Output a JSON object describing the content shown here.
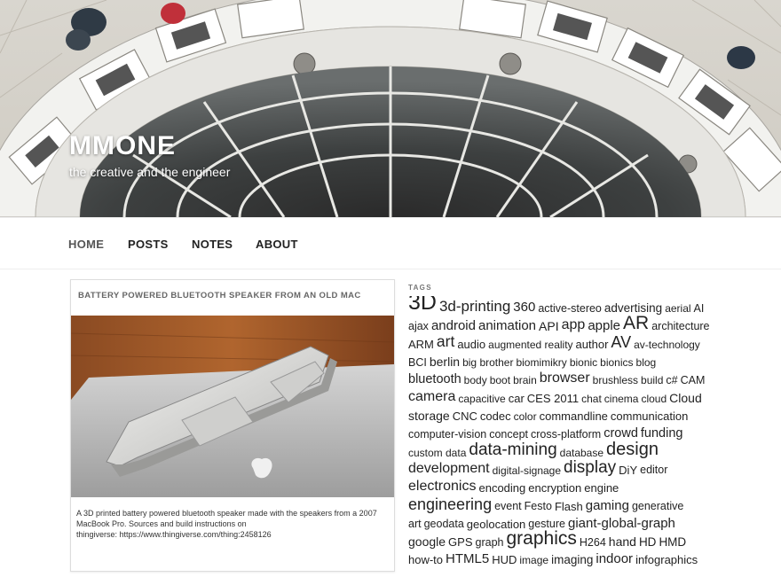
{
  "site": {
    "title": "MMONE",
    "tagline": "the creative and the engineer"
  },
  "nav": {
    "items": [
      {
        "label": "HOME",
        "name": "nav-item-home"
      },
      {
        "label": "POSTS",
        "name": "nav-item-posts"
      },
      {
        "label": "NOTES",
        "name": "nav-item-notes"
      },
      {
        "label": "ABOUT",
        "name": "nav-item-about"
      }
    ]
  },
  "post": {
    "title": "BATTERY POWERED BLUETOOTH SPEAKER FROM AN OLD MAC",
    "caption_line1": "A 3D printed battery powered bluetooth speaker made with the speakers from a 2007",
    "caption_line2": "MacBook Pro. Sources and build instructions on",
    "caption_line3": "thingiverse: https://www.thingiverse.com/thing:2458126"
  },
  "tags": {
    "heading": "TAGS",
    "lines": [
      [
        {
          "t": "3D",
          "s": 25
        },
        {
          "t": "3d-printing",
          "s": 17
        },
        {
          "t": "360",
          "s": 15
        },
        {
          "t": "active-stereo",
          "s": 12.5
        },
        {
          "t": "advertising",
          "s": 13.5
        },
        {
          "t": "aerial",
          "s": 12
        },
        {
          "t": "AI",
          "s": 12.5
        }
      ],
      [
        {
          "t": "ajax",
          "s": 12.5
        },
        {
          "t": "android",
          "s": 15
        },
        {
          "t": "animation",
          "s": 15
        },
        {
          "t": "API",
          "s": 14
        },
        {
          "t": "app",
          "s": 16
        },
        {
          "t": "apple",
          "s": 15
        },
        {
          "t": "AR",
          "s": 21
        },
        {
          "t": "architecture",
          "s": 12.5
        }
      ],
      [
        {
          "t": "ARM",
          "s": 13
        },
        {
          "t": "art",
          "s": 17.5
        },
        {
          "t": "audio",
          "s": 13
        },
        {
          "t": "augmented reality",
          "s": 12
        },
        {
          "t": "author",
          "s": 13
        },
        {
          "t": "AV",
          "s": 18
        },
        {
          "t": "av-technology",
          "s": 12
        }
      ],
      [
        {
          "t": "BCI",
          "s": 12.5
        },
        {
          "t": "berlin",
          "s": 14
        },
        {
          "t": "big brother",
          "s": 12
        },
        {
          "t": "biomimikry",
          "s": 12
        },
        {
          "t": "bionic",
          "s": 12
        },
        {
          "t": "bionics",
          "s": 12
        },
        {
          "t": "blog",
          "s": 12
        }
      ],
      [
        {
          "t": "bluetooth",
          "s": 14.5
        },
        {
          "t": "body",
          "s": 12
        },
        {
          "t": "boot",
          "s": 12
        },
        {
          "t": "brain",
          "s": 12
        },
        {
          "t": "browser",
          "s": 16
        },
        {
          "t": "brushless",
          "s": 12
        },
        {
          "t": "build",
          "s": 12
        },
        {
          "t": "c#",
          "s": 12.5
        },
        {
          "t": "CAM",
          "s": 12.5
        }
      ],
      [
        {
          "t": "camera",
          "s": 16
        },
        {
          "t": "capacitive",
          "s": 12
        },
        {
          "t": "car",
          "s": 13
        },
        {
          "t": "CES 2011",
          "s": 13
        },
        {
          "t": "chat",
          "s": 12
        },
        {
          "t": "cinema",
          "s": 12
        },
        {
          "t": "cloud",
          "s": 12
        },
        {
          "t": "Cloud",
          "s": 14
        }
      ],
      [
        {
          "t": "storage",
          "s": 14
        },
        {
          "t": "CNC",
          "s": 13
        },
        {
          "t": "codec",
          "s": 13
        },
        {
          "t": "color",
          "s": 12
        },
        {
          "t": "commandline",
          "s": 13
        },
        {
          "t": "communication",
          "s": 13
        }
      ],
      [
        {
          "t": "computer-vision",
          "s": 12.5
        },
        {
          "t": "concept",
          "s": 12.5
        },
        {
          "t": "cross-platform",
          "s": 12.5
        },
        {
          "t": "crowd",
          "s": 14.5
        },
        {
          "t": "funding",
          "s": 14.5
        }
      ],
      [
        {
          "t": "custom data",
          "s": 12
        },
        {
          "t": "data-mining",
          "s": 19
        },
        {
          "t": "database",
          "s": 12
        },
        {
          "t": "design",
          "s": 20
        }
      ],
      [
        {
          "t": "development",
          "s": 16
        },
        {
          "t": "digital-signage",
          "s": 12
        },
        {
          "t": "display",
          "s": 19
        },
        {
          "t": "DiY",
          "s": 13
        },
        {
          "t": "editor",
          "s": 12.5
        }
      ],
      [
        {
          "t": "electronics",
          "s": 16
        },
        {
          "t": "encoding",
          "s": 13
        },
        {
          "t": "encryption",
          "s": 13
        },
        {
          "t": "engine",
          "s": 13
        }
      ],
      [
        {
          "t": "engineering",
          "s": 18
        },
        {
          "t": "event",
          "s": 12.5
        },
        {
          "t": "Festo",
          "s": 12.5
        },
        {
          "t": "Flash",
          "s": 13
        },
        {
          "t": "gaming",
          "s": 15
        },
        {
          "t": "generative",
          "s": 12.5
        }
      ],
      [
        {
          "t": "art",
          "s": 12.5
        },
        {
          "t": "geodata",
          "s": 12.5
        },
        {
          "t": "geolocation",
          "s": 13
        },
        {
          "t": "gesture",
          "s": 12.5
        },
        {
          "t": "giant-global-graph",
          "s": 15
        }
      ],
      [
        {
          "t": "google",
          "s": 14
        },
        {
          "t": "GPS",
          "s": 13
        },
        {
          "t": "graph",
          "s": 12.5
        },
        {
          "t": "graphics",
          "s": 21
        },
        {
          "t": "H264",
          "s": 12.5
        },
        {
          "t": "hand",
          "s": 14
        },
        {
          "t": "HD",
          "s": 13.5
        },
        {
          "t": "HMD",
          "s": 13.5
        }
      ],
      [
        {
          "t": "how-to",
          "s": 13
        },
        {
          "t": "HTML5",
          "s": 15
        },
        {
          "t": "HUD",
          "s": 13
        },
        {
          "t": "image",
          "s": 12
        },
        {
          "t": "imaging",
          "s": 13.5
        },
        {
          "t": "indoor",
          "s": 15
        },
        {
          "t": "infographics",
          "s": 13
        }
      ]
    ]
  },
  "colors": {
    "text": "#222222",
    "muted": "#666666",
    "border": "#dddddd",
    "white": "#ffffff"
  }
}
